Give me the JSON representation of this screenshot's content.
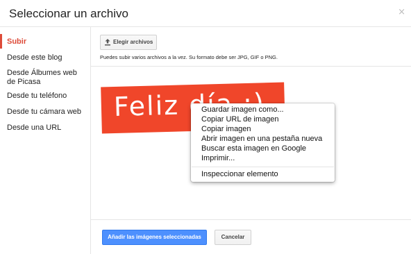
{
  "dialog": {
    "title": "Seleccionar un archivo",
    "close_symbol": "×"
  },
  "sidebar": {
    "items": [
      {
        "label": "Subir",
        "active": true
      },
      {
        "label": "Desde este blog",
        "active": false
      },
      {
        "label": "Desde Álbumes web de Picasa",
        "active": false
      },
      {
        "label": "Desde tu teléfono",
        "active": false
      },
      {
        "label": "Desde tu cámara web",
        "active": false
      },
      {
        "label": "Desde una URL",
        "active": false
      }
    ]
  },
  "upload": {
    "button_label": "Elegir archivos",
    "hint": "Puedes subir varios archivos a la vez. Su formato debe ser JPG, GIF o PNG."
  },
  "image": {
    "text": "Feliz día :)",
    "background_color": "#f0462a"
  },
  "context_menu": {
    "items": [
      "Guardar imagen como...",
      "Copiar URL de imagen",
      "Copiar imagen",
      "Abrir imagen en una pestaña nueva",
      "Buscar esta imagen en Google",
      "Imprimir..."
    ],
    "inspect": "Inspeccionar elemento"
  },
  "footer": {
    "add_button": "Añadir las imágenes seleccionadas",
    "cancel_button": "Cancelar"
  },
  "colors": {
    "accent_red": "#dd4b39",
    "primary_blue": "#4d90fe"
  }
}
